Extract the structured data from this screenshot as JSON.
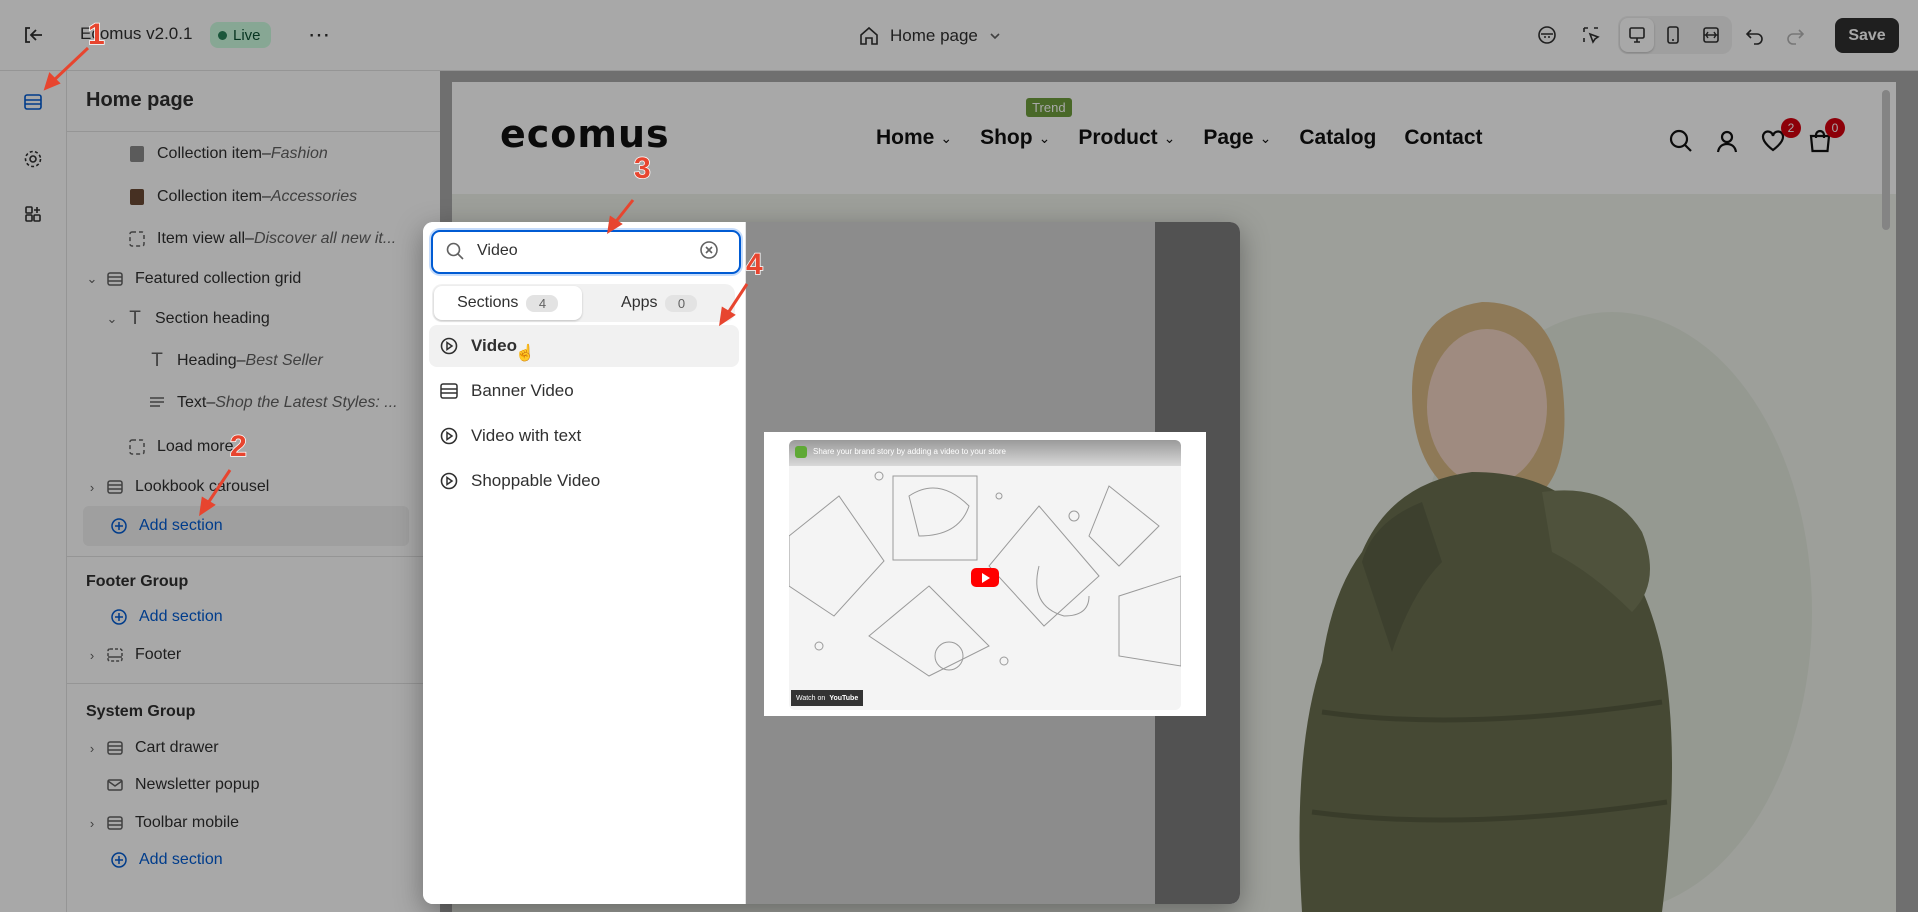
{
  "topbar": {
    "store_name": "Ecomus v2.0.1",
    "live_badge": "Live",
    "page_selector": "Home page",
    "save_label": "Save"
  },
  "sidebar": {
    "title": "Home page",
    "items": [
      {
        "label": "Collection item",
        "sub": "Fashion",
        "icon": "thumbnail-icon"
      },
      {
        "label": "Collection item",
        "sub": "Accessories",
        "icon": "thumbnail-icon"
      },
      {
        "label": "Item view all",
        "sub": "Discover all new it...",
        "icon": "block-dashed-icon"
      },
      {
        "label": "Featured collection grid",
        "sub": "",
        "icon": "section-icon"
      },
      {
        "label": "Section heading",
        "sub": "",
        "icon": "text-icon"
      },
      {
        "label": "Heading",
        "sub": "Best Seller",
        "icon": "text-icon"
      },
      {
        "label": "Text",
        "sub": "Shop the Latest Styles: ...",
        "icon": "paragraph-icon"
      },
      {
        "label": "Load more",
        "sub": "",
        "icon": "block-dashed-icon"
      },
      {
        "label": "Lookbook carousel",
        "sub": "",
        "icon": "section-icon"
      }
    ],
    "add_section": "Add section",
    "footer_group": {
      "title": "Footer Group",
      "add_section": "Add section",
      "items": [
        {
          "label": "Footer"
        }
      ]
    },
    "system_group": {
      "title": "System Group",
      "items": [
        {
          "label": "Cart drawer"
        },
        {
          "label": "Newsletter popup"
        },
        {
          "label": "Toolbar mobile"
        }
      ],
      "add_section": "Add section"
    },
    "separator": " – "
  },
  "popup": {
    "search_value": "Video",
    "tabs": [
      {
        "label": "Sections",
        "count": "4"
      },
      {
        "label": "Apps",
        "count": "0"
      }
    ],
    "results": [
      "Video",
      "Banner Video",
      "Video with text",
      "Shoppable Video"
    ],
    "preview": {
      "video_title": "Share your brand story by adding a video to your store",
      "watch_on": "Watch on",
      "youtube": "YouTube"
    }
  },
  "store": {
    "logo": "ecomus",
    "nav": [
      "Home",
      "Shop",
      "Product",
      "Page",
      "Catalog",
      "Contact"
    ],
    "trend_badge": "Trend",
    "wishlist_count": "2",
    "cart_count": "0"
  },
  "annotations": [
    "1",
    "2",
    "3",
    "4"
  ],
  "colors": {
    "accent": "#005bd3",
    "live_bg": "#cdfee1",
    "live_dot": "#29845a",
    "annotation": "#e7452f",
    "trend": "#6f9e3e",
    "badge_red": "#d7000f",
    "jacket": "#6b7050"
  }
}
